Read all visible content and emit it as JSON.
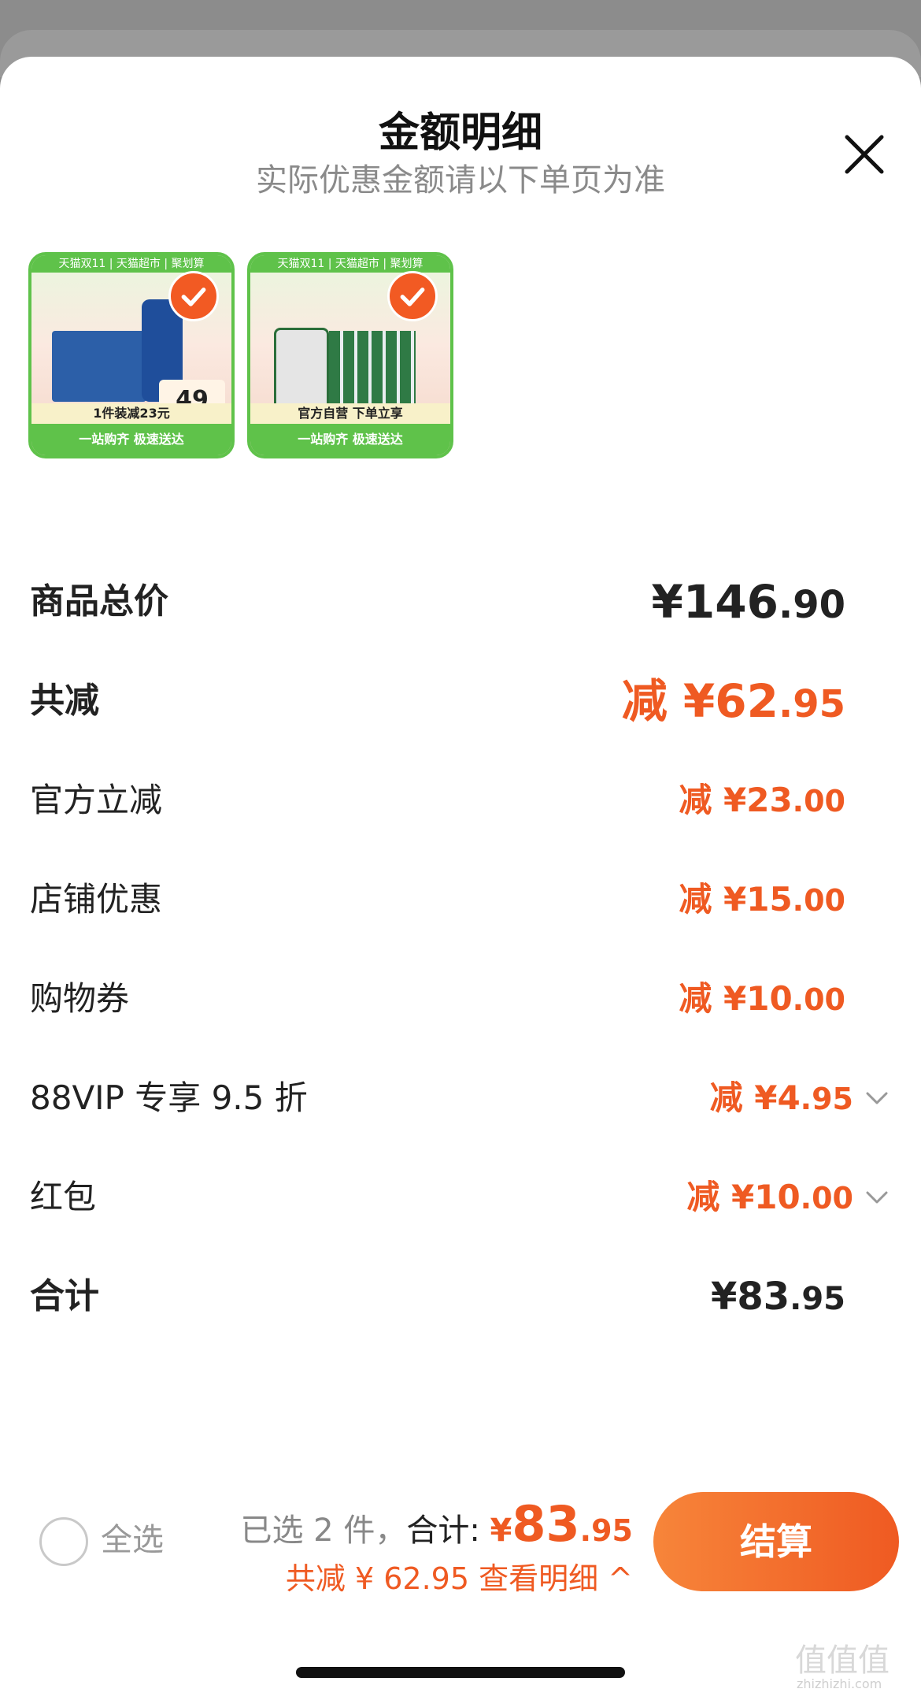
{
  "header": {
    "title": "金额明细",
    "subtitle": "实际优惠金额请以下单页为准"
  },
  "products": [
    {
      "banner": "天猫双11 | 天猫超市 | 聚划算",
      "promo": "1件装减23元",
      "tagline": "一站购齐 极速送达",
      "price": "49",
      "selected": true
    },
    {
      "banner": "天猫双11 | 天猫超市 | 聚划算",
      "promo": "官方自营 下单立享",
      "tagline": "一站购齐 极速送达",
      "selected": true
    }
  ],
  "rows": [
    {
      "label": "商品总价",
      "prefix": "",
      "currency": "¥",
      "int": "146",
      "dec": ".90",
      "style": "total",
      "chevron": false
    },
    {
      "label": "共减",
      "prefix": "减 ",
      "currency": "¥",
      "int": "62",
      "dec": ".95",
      "style": "big-orange",
      "chevron": false
    },
    {
      "label": "官方立减",
      "prefix": "减 ",
      "currency": "¥",
      "int": "23",
      "dec": ".00",
      "style": "orange",
      "chevron": false
    },
    {
      "label": "店铺优惠",
      "prefix": "减 ",
      "currency": "¥",
      "int": "15",
      "dec": ".00",
      "style": "orange",
      "chevron": false
    },
    {
      "label": "购物券",
      "prefix": "减 ",
      "currency": "¥",
      "int": "10",
      "dec": ".00",
      "style": "orange",
      "chevron": false
    },
    {
      "label": "88VIP 专享 9.5 折",
      "prefix": "减 ",
      "currency": "¥",
      "int": "4",
      "dec": ".95",
      "style": "orange",
      "chevron": true
    },
    {
      "label": "红包",
      "prefix": "减 ",
      "currency": "¥",
      "int": "10",
      "dec": ".00",
      "style": "orange",
      "chevron": true
    },
    {
      "label": "合计",
      "prefix": "",
      "currency": "¥",
      "int": "83",
      "dec": ".95",
      "style": "total",
      "chevron": false
    }
  ],
  "footer": {
    "select_all": "全选",
    "selected_text": "已选 2 件，",
    "total_label": "合计: ",
    "currency": "¥",
    "total_int": "83",
    "total_dec": ".95",
    "discount_text": "共减 ¥ 62.95  查看明细 ^",
    "checkout_label": "结算"
  },
  "watermark": {
    "main": "值值值",
    "sub": "zhizhizhi.com"
  },
  "colors": {
    "accent": "#ef5a22",
    "green": "#5fc24a"
  }
}
